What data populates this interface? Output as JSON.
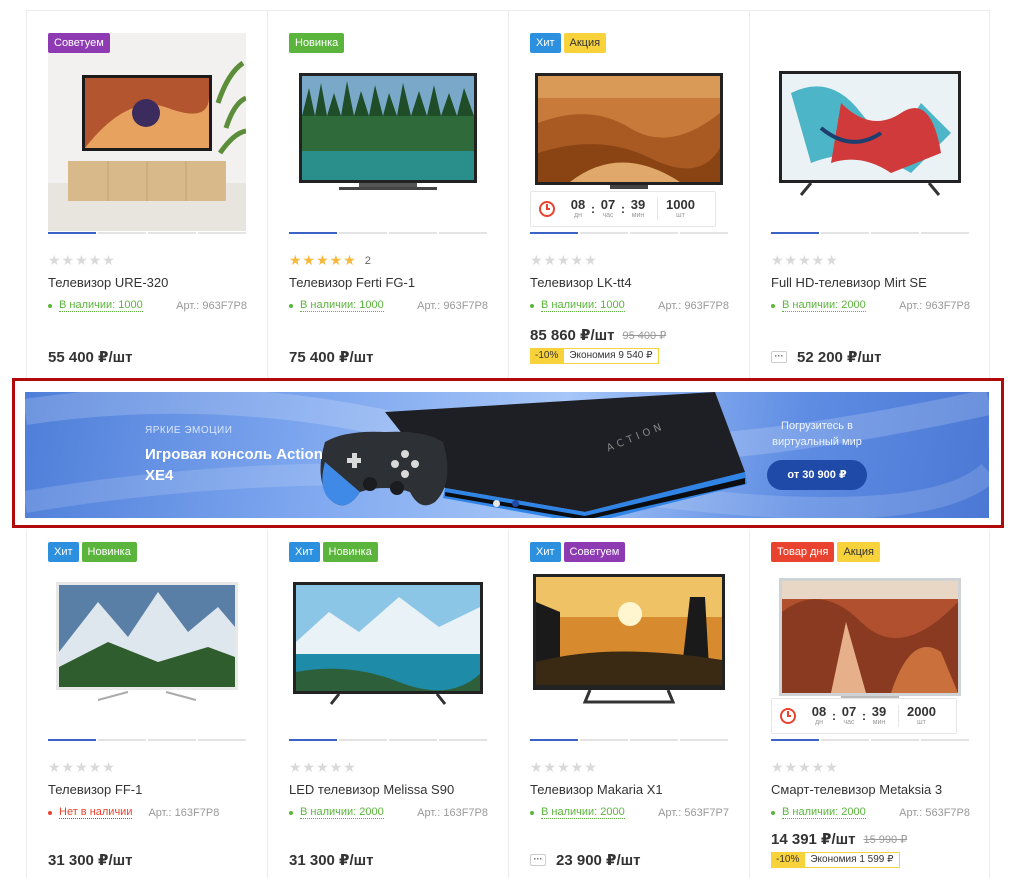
{
  "products_top": [
    {
      "badges": [
        {
          "label": "Советуем",
          "color": "purple"
        }
      ],
      "image": "tv-on-cabinet",
      "rating": 0,
      "reviews": "",
      "title": "Телевизор URE-320",
      "stock": "В наличии: 1000",
      "in_stock": true,
      "sku": "Арт.: 963F7P8",
      "price": "55 400 ₽/шт",
      "old_price": "",
      "has_timer": false
    },
    {
      "badges": [
        {
          "label": "Новинка",
          "color": "green"
        }
      ],
      "image": "tv-forest",
      "rating": 5,
      "reviews": "2",
      "title": "Телевизор Ferti FG-1",
      "stock": "В наличии: 1000",
      "in_stock": true,
      "sku": "Арт.: 963F7P8",
      "price": "75 400 ₽/шт",
      "old_price": "",
      "has_timer": false
    },
    {
      "badges": [
        {
          "label": "Хит",
          "color": "blue"
        },
        {
          "label": "Акция",
          "color": "yellow"
        }
      ],
      "image": "tv-dunes",
      "rating": 0,
      "reviews": "",
      "title": "Телевизор LK-tt4",
      "stock": "В наличии: 1000",
      "in_stock": true,
      "sku": "Арт.: 963F7P8",
      "price": "85 860 ₽/шт",
      "old_price": "95 400 ₽",
      "discount": "-10%",
      "economy": "Экономия 9 540 ₽",
      "has_timer": true,
      "timer": {
        "days": "08",
        "hours": "07",
        "minutes": "39",
        "qty": "1000",
        "days_label": "дн",
        "hours_label": "час",
        "minutes_label": "мин",
        "qty_label": "шт"
      }
    },
    {
      "badges": [],
      "image": "tv-abstract",
      "rating": 0,
      "reviews": "",
      "title": "Full HD-телевизор Mirt SE",
      "stock": "В наличии: 2000",
      "in_stock": true,
      "sku": "Арт.: 963F7P8",
      "price": "52 200 ₽/шт",
      "old_price": "",
      "has_more": true,
      "has_timer": false
    }
  ],
  "banner": {
    "kicker": "Яркие эмоции",
    "headline": "Игровая консоль Action XE4",
    "subline": "Погрузитесь в виртуальный мир",
    "cta": "от 30 900 ₽",
    "console_text": "ACTION",
    "slides": 2,
    "active_slide": 2
  },
  "products_bottom": [
    {
      "badges": [
        {
          "label": "Хит",
          "color": "blue"
        },
        {
          "label": "Новинка",
          "color": "green"
        }
      ],
      "image": "tv-mountains",
      "rating": 0,
      "title": "Телевизор FF-1",
      "stock": "Нет в наличии",
      "in_stock": false,
      "sku": "Арт.: 163F7P8",
      "price": "31 300 ₽/шт",
      "has_timer": false
    },
    {
      "badges": [
        {
          "label": "Хит",
          "color": "blue"
        },
        {
          "label": "Новинка",
          "color": "green"
        }
      ],
      "image": "tv-glacier",
      "rating": 0,
      "title": "LED телевизор Melissa S90",
      "stock": "В наличии: 2000",
      "in_stock": true,
      "sku": "Арт.: 163F7P8",
      "price": "31 300 ₽/шт",
      "has_timer": false
    },
    {
      "badges": [
        {
          "label": "Хит",
          "color": "blue"
        },
        {
          "label": "Советуем",
          "color": "purple"
        }
      ],
      "image": "tv-sunset",
      "rating": 0,
      "title": "Телевизор Makaria X1",
      "stock": "В наличии: 2000",
      "in_stock": true,
      "sku": "Арт.: 563F7P7",
      "price": "23 900 ₽/шт",
      "has_more": true,
      "has_timer": false
    },
    {
      "badges": [
        {
          "label": "Товар дня",
          "color": "red"
        },
        {
          "label": "Акция",
          "color": "yellow"
        }
      ],
      "image": "tv-canyon",
      "rating": 0,
      "title": "Смарт-телевизор Metaksia 3",
      "stock": "В наличии: 2000",
      "in_stock": true,
      "sku": "Арт.: 563F7P8",
      "price": "14 391 ₽/шт",
      "old_price": "15 990 ₽",
      "discount": "-10%",
      "economy": "Экономия 1 599 ₽",
      "has_timer": true,
      "timer": {
        "days": "08",
        "hours": "07",
        "minutes": "39",
        "qty": "2000",
        "days_label": "дн",
        "hours_label": "час",
        "minutes_label": "мин",
        "qty_label": "шт"
      }
    }
  ],
  "colors": {
    "accent_blue": "#3a62c7",
    "badge_purple": "#8e3bb3",
    "badge_green": "#5bb53c",
    "badge_blue": "#2d90de",
    "badge_yellow": "#f7d23a",
    "badge_red": "#e9432f",
    "banner_highlight": "#b00a0a"
  }
}
